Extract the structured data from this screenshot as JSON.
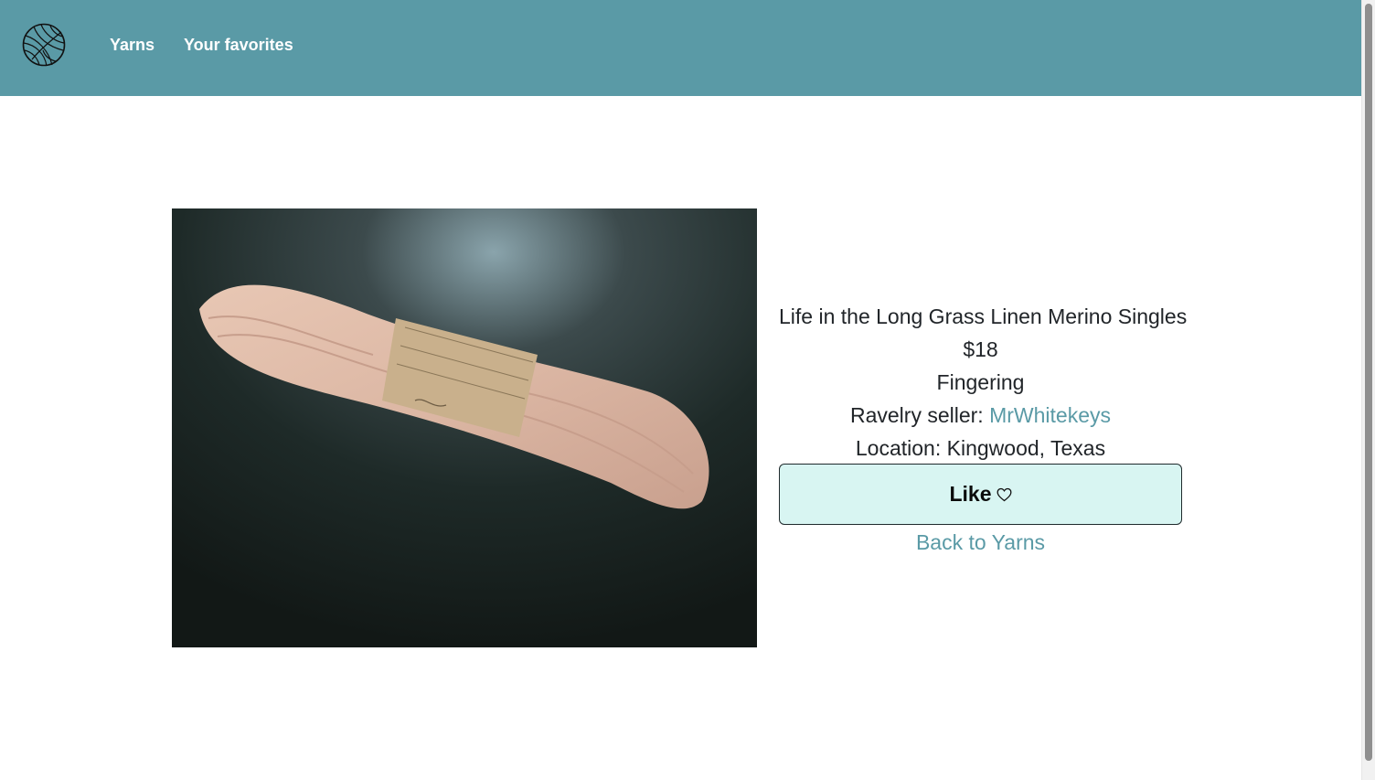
{
  "nav": {
    "logo_icon": "yarn-ball-icon",
    "links": [
      "Yarns",
      "Your favorites"
    ]
  },
  "product": {
    "image_alt": "skein of pale pink linen merino yarn",
    "title": "Life in the Long Grass Linen Merino Singles",
    "price": "$18",
    "weight": "Fingering",
    "seller_label": "Ravelry seller: ",
    "seller_name": "MrWhitekeys",
    "location": "Location: Kingwood, Texas"
  },
  "actions": {
    "like_label": "Like",
    "like_icon": "heart-outline-icon",
    "back_label": "Back to Yarns"
  },
  "colors": {
    "nav_bg": "#5a9aa6",
    "link": "#5a9aa6",
    "like_bg": "#d8f5f2",
    "text": "#212529"
  }
}
